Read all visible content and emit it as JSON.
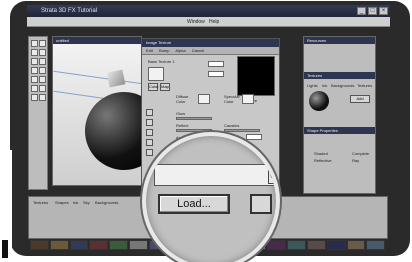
{
  "window": {
    "title": "Strata 3D FX Tutorial",
    "menus": [
      "Window",
      "Help"
    ]
  },
  "viewport": {
    "title": "untitled"
  },
  "dialog": {
    "title": "Image Texture",
    "tabs": [
      "Edit",
      "Bump",
      "Alpha",
      "Cancel"
    ],
    "name_label": "Base Texture 1",
    "labels": [
      "Diffuse",
      "Color",
      "Specular",
      "Color",
      "Glow",
      "Reflect",
      "Ambient",
      "Caustics",
      "Refract"
    ],
    "small_buttons": [
      "Color",
      "Map"
    ],
    "swatch_label": "Texture"
  },
  "zoom": {
    "load_button": "Load...",
    "side_button_glyph": "W"
  },
  "right_panel": {
    "titles": [
      "Resources",
      "Textures",
      "Shape Properties"
    ],
    "tabs": [
      "Lights",
      "Ink",
      "Backgrounds",
      "Textures"
    ],
    "add_button": "Add",
    "options": [
      "Shaded",
      "Reflective",
      "Complete",
      "Ray"
    ]
  },
  "bottom": {
    "labels": [
      "Textures",
      "Shapes",
      "Ink",
      "Sky",
      "Backgrounds"
    ]
  },
  "colors": {
    "frame": "#2a2a2a",
    "titlebar": "#2e3550",
    "panel": "#c8c8c8"
  }
}
